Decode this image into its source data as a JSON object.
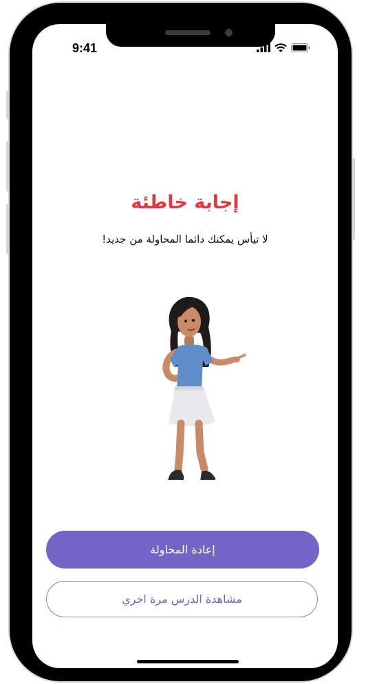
{
  "status_bar": {
    "time": "9:41",
    "icons": [
      "signal-icon",
      "wifi-icon",
      "battery-icon"
    ]
  },
  "result": {
    "title": "إجابة خاطئة",
    "subtitle": "لا تيأس يمكنك دائما المحاولة من جديد!"
  },
  "illustration": {
    "name": "character-pointing-illustration"
  },
  "actions": {
    "retry_label": "إعادة المحاولة",
    "rewatch_label": "مشاهدة الدرس مرة اخري"
  },
  "colors": {
    "accent": "#7364c6",
    "error": "#e0393d"
  }
}
